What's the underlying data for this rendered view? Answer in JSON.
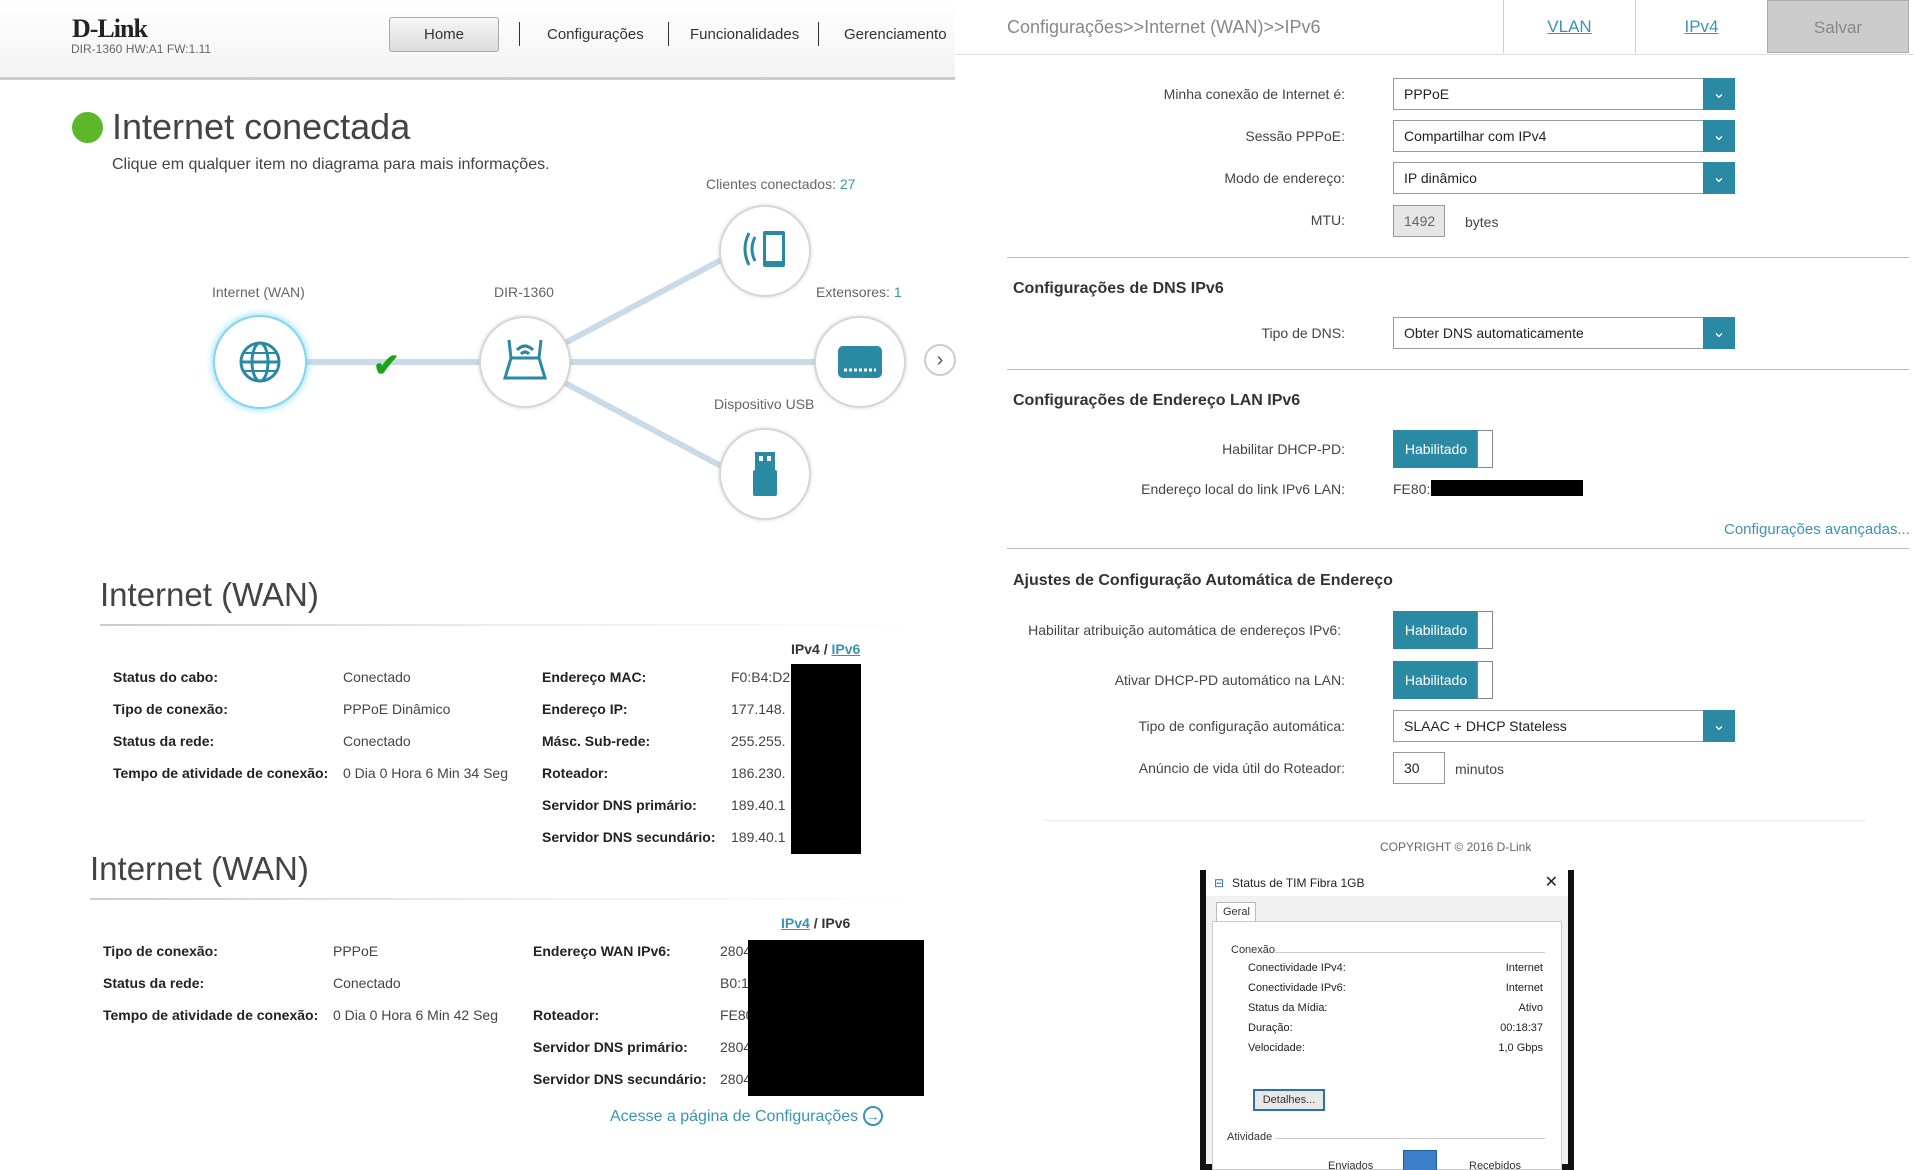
{
  "header": {
    "logo": "D-Link",
    "model": "DIR-1360 HW:A1 FW:1.11",
    "nav": [
      "Home",
      "Configurações",
      "Funcionalidades",
      "Gerenciamento"
    ]
  },
  "status": {
    "title": "Internet conectada",
    "subtitle": "Clique em qualquer item no diagrama para mais informações."
  },
  "diagram": {
    "internet": "Internet (WAN)",
    "router": "DIR-1360",
    "clients_label": "Clientes conectados:",
    "clients_count": "27",
    "extenders_label": "Extensores:",
    "extenders_count": "1",
    "usb": "Dispositivo USB"
  },
  "wan4": {
    "title": "Internet (WAN)",
    "toggle_a": "IPv4",
    "toggle_sep": "/",
    "toggle_b": "IPv6",
    "left": [
      [
        "Status do cabo:",
        "Conectado"
      ],
      [
        "Tipo de conexão:",
        "PPPoE Dinâmico"
      ],
      [
        "Status da rede:",
        "Conectado"
      ],
      [
        "Tempo de atividade de conexão:",
        "0 Dia 0 Hora 6 Min 34 Seg"
      ]
    ],
    "right": [
      [
        "Endereço MAC:",
        "F0:B4:D2"
      ],
      [
        "Endereço IP:",
        "177.148."
      ],
      [
        "Másc. Sub-rede:",
        "255.255."
      ],
      [
        "Roteador:",
        "186.230."
      ],
      [
        "Servidor DNS primário:",
        "189.40.1"
      ],
      [
        "Servidor DNS secundário:",
        "189.40.1"
      ]
    ]
  },
  "wan6": {
    "title": "Internet (WAN)",
    "toggle_a": "IPv4",
    "toggle_sep": "/",
    "toggle_b": "IPv6",
    "left": [
      [
        "Tipo de conexão:",
        "PPPoE"
      ],
      [
        "Status da rede:",
        "Conectado"
      ],
      [
        "Tempo de atividade de conexão:",
        "0 Dia 0 Hora 6 Min 42 Seg"
      ]
    ],
    "right": [
      [
        "Endereço WAN IPv6:",
        "2804"
      ],
      [
        "",
        "B0:1"
      ],
      [
        "Roteador:",
        "FE80"
      ],
      [
        "Servidor DNS primário:",
        "2804"
      ],
      [
        "Servidor DNS secundário:",
        "2804"
      ]
    ],
    "settings_link": "Acesse a página de Configurações"
  },
  "right": {
    "breadcrumb": "Configurações>>Internet (WAN)>>IPv6",
    "tabs": [
      "VLAN",
      "IPv4"
    ],
    "save": "Salvar",
    "conn_label": "Minha conexão de Internet é:",
    "conn_value": "PPPoE",
    "session_label": "Sessão PPPoE:",
    "session_value": "Compartilhar com IPv4",
    "mode_label": "Modo de endereço:",
    "mode_value": "IP dinâmico",
    "mtu_label": "MTU:",
    "mtu_value": "1492",
    "mtu_unit": "bytes",
    "dns_section": "Configurações de DNS IPv6",
    "dns_label": "Tipo de DNS:",
    "dns_value": "Obter DNS automaticamente",
    "lan_section": "Configurações de Endereço LAN IPv6",
    "dhcppd_label": "Habilitar DHCP-PD:",
    "enabled": "Habilitado",
    "linklocal_label": "Endereço local do link IPv6 LAN:",
    "linklocal_value": "FE80:",
    "advanced": "Configurações avançadas...",
    "auto_section": "Ajustes de Configuração Automática de Endereço",
    "auto_assign_label": "Habilitar atribuição automática de endereços IPv6:",
    "auto_pd_label": "Ativar DHCP-PD automático na LAN:",
    "auto_type_label": "Tipo de configuração automática:",
    "auto_type_value": "SLAAC + DHCP Stateless",
    "lifetime_label": "Anúncio de vida útil do Roteador:",
    "lifetime_value": "30",
    "lifetime_unit": "minutos",
    "copyright": "COPYRIGHT © 2016 D-Link"
  },
  "dialog": {
    "title": "Status de TIM Fibra 1GB",
    "tab": "Geral",
    "group": "Conexão",
    "rows": [
      [
        "Conectividade IPv4:",
        "Internet"
      ],
      [
        "Conectividade IPv6:",
        "Internet"
      ],
      [
        "Status da Mídia:",
        "Ativo"
      ],
      [
        "Duração:",
        "00:18:37"
      ],
      [
        "Velocidade:",
        "1,0 Gbps"
      ]
    ],
    "details": "Detalhes...",
    "activity": "Atividade",
    "sent": "Enviados",
    "received": "Recebidos"
  },
  "colors": {
    "accent": "#2a8aa3",
    "link": "#3a93b6",
    "ok": "#5cb82a"
  }
}
